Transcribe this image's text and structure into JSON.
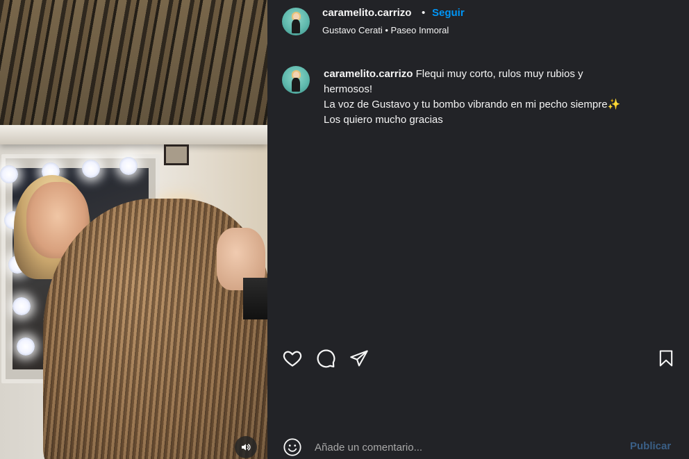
{
  "post": {
    "username": "caramelito.carrizo",
    "separator": "•",
    "follow_label": "Seguir",
    "audio": "Gustavo Cerati • Paseo Inmoral"
  },
  "caption": {
    "username": "caramelito.carrizo",
    "lines": [
      "Flequi muy corto, rulos muy rubios y",
      "hermosos!",
      "La voz de Gustavo y tu bombo vibrando en mi pecho siempre✨",
      "Los quiero mucho gracias"
    ]
  },
  "comment_box": {
    "placeholder": "Añade un comentario...",
    "publish_label": "Publicar"
  },
  "icons": {
    "volume": "volume-icon",
    "like": "heart-icon",
    "comment": "comment-icon",
    "share": "send-icon",
    "save": "bookmark-icon",
    "emoji": "emoji-icon"
  },
  "colors": {
    "panel_bg": "#222327",
    "text": "#f5f5f5",
    "link_blue": "#0095f6",
    "publish_disabled": "#3a5f86"
  }
}
